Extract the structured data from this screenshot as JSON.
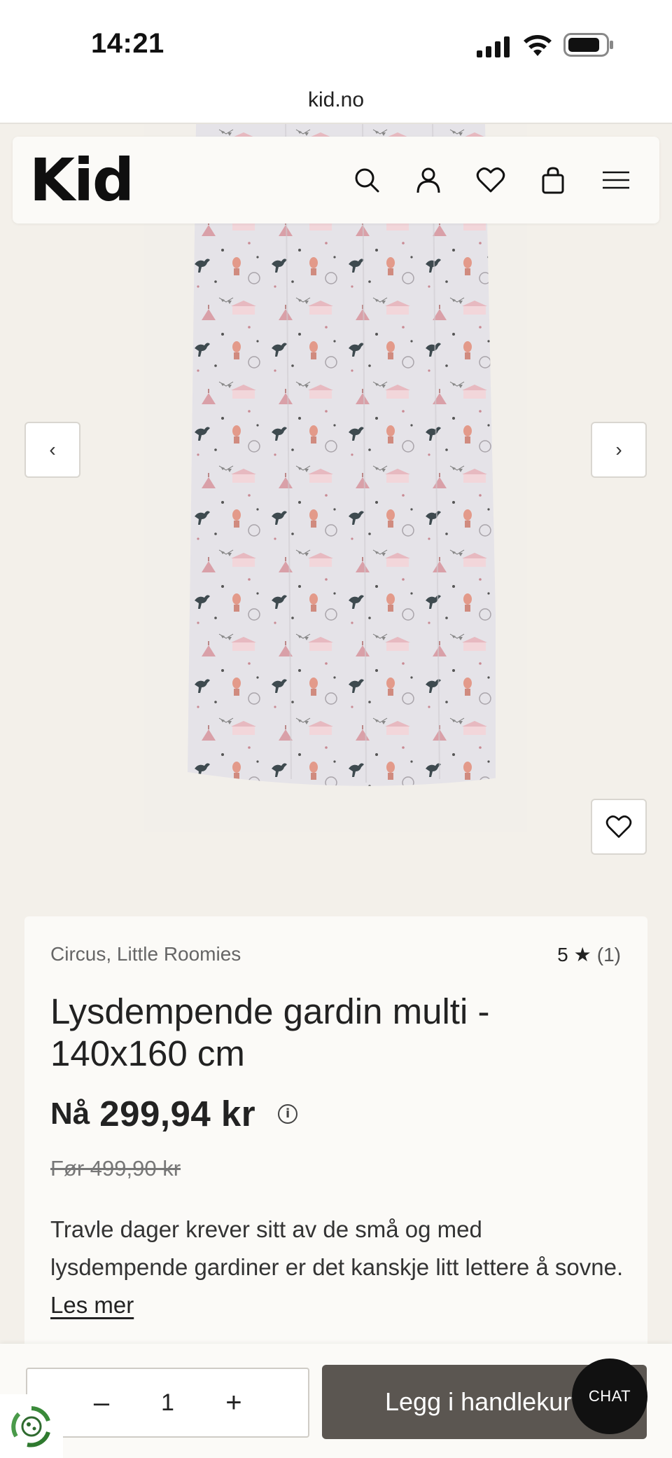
{
  "status_bar": {
    "time": "14:21",
    "url": "kid.no"
  },
  "header": {
    "logo": "Kid",
    "icons": [
      "search-icon",
      "account-icon",
      "heart-icon",
      "bag-icon",
      "menu-icon"
    ]
  },
  "gallery": {
    "prev_label": "‹",
    "next_label": "›"
  },
  "product": {
    "brand": "Circus, Little Roomies",
    "rating_value": "5",
    "rating_star": "★",
    "rating_count": "(1)",
    "title": "Lysdempende gardin multi - 140x160 cm",
    "price_prefix": "Nå",
    "price": "299,94 kr",
    "old_price": "Før 499,90 kr",
    "description": "Travle dager krever sitt av de små og med lysdempende gardiner er det kanskje litt lettere å sovne.",
    "read_more": "Les mer"
  },
  "cart_bar": {
    "minus": "–",
    "quantity": "1",
    "plus": "+",
    "add_to_cart": "Legg i handlekurv",
    "chat": "CHAT"
  },
  "colors": {
    "background": "#f3f0ea",
    "card": "#fbfaf7",
    "button": "#5b5651",
    "chat": "#111111",
    "curtain": "#e4e2e6",
    "pattern_pink": "#d9a0a8"
  }
}
